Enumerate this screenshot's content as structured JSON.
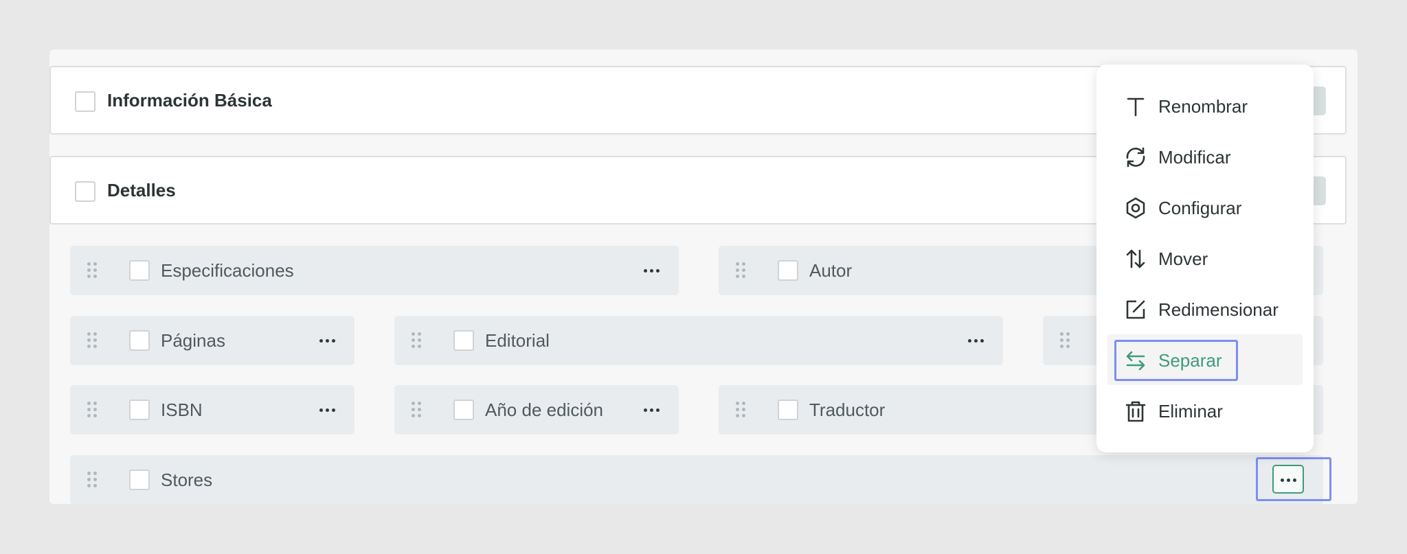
{
  "sections": [
    {
      "title": "Información Básica"
    },
    {
      "title": "Detalles"
    }
  ],
  "fields": {
    "especificaciones": "Especificaciones",
    "autor": "Autor",
    "paginas": "Páginas",
    "editorial": "Editorial",
    "isbn": "ISBN",
    "anio_edicion": "Año de edición",
    "traductor": "Traductor",
    "stores": "Stores"
  },
  "context_menu": {
    "items": [
      {
        "label": "Renombrar",
        "icon": "text-icon"
      },
      {
        "label": "Modificar",
        "icon": "refresh-icon"
      },
      {
        "label": "Configurar",
        "icon": "hexagon-settings-icon"
      },
      {
        "label": "Mover",
        "icon": "arrows-up-down-icon"
      },
      {
        "label": "Redimensionar",
        "icon": "resize-edit-icon"
      },
      {
        "label": "Separar",
        "icon": "arrows-left-right-icon",
        "active": true
      },
      {
        "label": "Eliminar",
        "icon": "trash-icon"
      }
    ]
  },
  "colors": {
    "accent": "#3f9a7e",
    "highlight": "#7c8ef2",
    "field_bg": "#e9ecee"
  }
}
